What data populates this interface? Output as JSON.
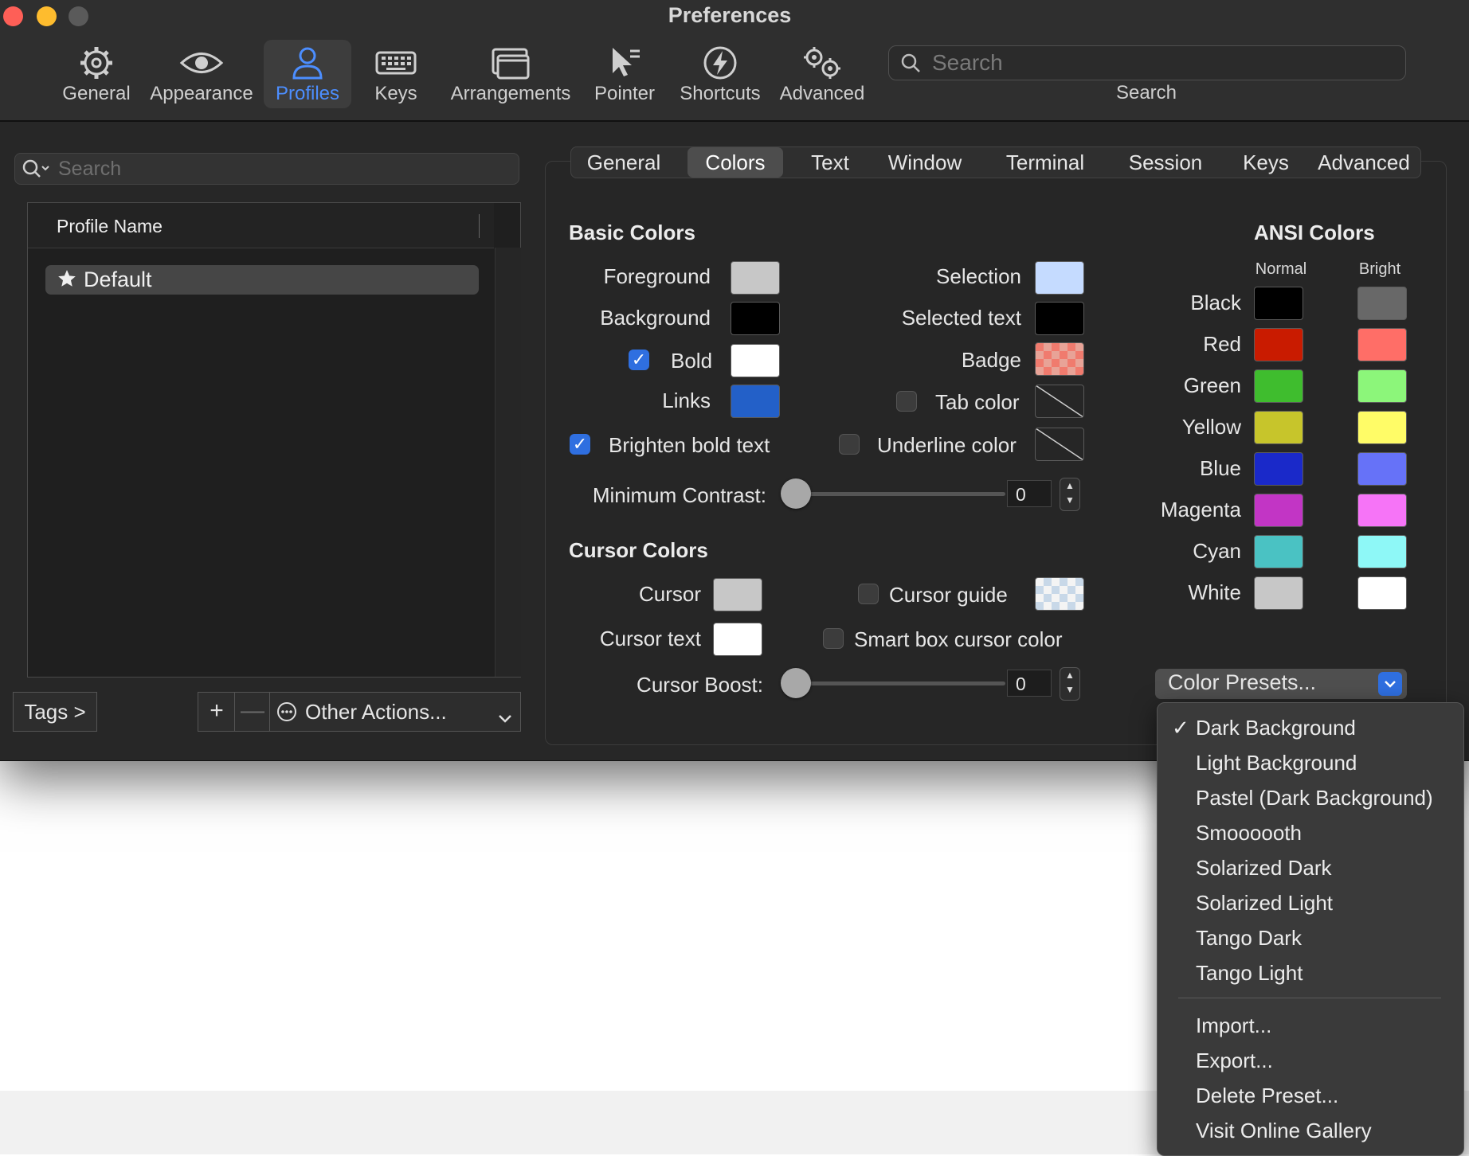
{
  "window": {
    "title": "Preferences"
  },
  "toolbar": {
    "items": [
      {
        "label": "General",
        "icon": "gear-icon"
      },
      {
        "label": "Appearance",
        "icon": "eye-icon"
      },
      {
        "label": "Profiles",
        "icon": "person-icon",
        "selected": true
      },
      {
        "label": "Keys",
        "icon": "keyboard-icon"
      },
      {
        "label": "Arrangements",
        "icon": "windows-icon"
      },
      {
        "label": "Pointer",
        "icon": "pointer-icon"
      },
      {
        "label": "Shortcuts",
        "icon": "bolt-icon"
      },
      {
        "label": "Advanced",
        "icon": "gears-icon"
      }
    ],
    "search_placeholder": "Search",
    "search_label": "Search"
  },
  "sidebar": {
    "search_placeholder": "Search",
    "column_header": "Profile Name",
    "profiles": [
      {
        "name": "Default",
        "starred": true,
        "selected": true
      }
    ],
    "tags_label": "Tags >",
    "add_label": "+",
    "remove_label": "—",
    "other_actions_label": "Other Actions..."
  },
  "tabs": [
    "General",
    "Colors",
    "Text",
    "Window",
    "Terminal",
    "Session",
    "Keys",
    "Advanced"
  ],
  "active_tab": "Colors",
  "basic_colors": {
    "heading": "Basic Colors",
    "foreground": {
      "label": "Foreground",
      "color": "#c7c7c7"
    },
    "background": {
      "label": "Background",
      "color": "#000000"
    },
    "bold": {
      "label": "Bold",
      "color": "#ffffff",
      "checked": true
    },
    "links": {
      "label": "Links",
      "color": "#2360c8"
    },
    "selection": {
      "label": "Selection",
      "color": "#c5dbff"
    },
    "selected_text": {
      "label": "Selected text",
      "color": "#000000"
    },
    "badge": {
      "label": "Badge",
      "color": "#f07b6e"
    },
    "tab_color": {
      "label": "Tab color",
      "checked": false
    },
    "underline_color": {
      "label": "Underline color",
      "checked": false
    },
    "brighten_bold": {
      "label": "Brighten bold text",
      "checked": true
    },
    "minimum_contrast": {
      "label": "Minimum Contrast:",
      "value": "0"
    }
  },
  "cursor_colors": {
    "heading": "Cursor Colors",
    "cursor": {
      "label": "Cursor",
      "color": "#c7c7c7"
    },
    "cursor_text": {
      "label": "Cursor text",
      "color": "#ffffff"
    },
    "cursor_guide": {
      "label": "Cursor guide",
      "checked": false
    },
    "smart_box": {
      "label": "Smart box cursor color",
      "checked": false
    },
    "cursor_boost": {
      "label": "Cursor Boost:",
      "value": "0"
    }
  },
  "ansi": {
    "heading": "ANSI Colors",
    "normal_label": "Normal",
    "bright_label": "Bright",
    "rows": [
      {
        "name": "Black",
        "normal": "#000000",
        "bright": "#686868"
      },
      {
        "name": "Red",
        "normal": "#c91b00",
        "bright": "#ff6e67"
      },
      {
        "name": "Green",
        "normal": "#3fbd2e",
        "bright": "#8cf67a"
      },
      {
        "name": "Yellow",
        "normal": "#c7c52b",
        "bright": "#fffc67"
      },
      {
        "name": "Blue",
        "normal": "#1a29c9",
        "bright": "#6672f8"
      },
      {
        "name": "Magenta",
        "normal": "#c235c5",
        "bright": "#f674f7"
      },
      {
        "name": "Cyan",
        "normal": "#4ac2c3",
        "bright": "#8ef8f7"
      },
      {
        "name": "White",
        "normal": "#c7c7c7",
        "bright": "#ffffff"
      }
    ]
  },
  "color_presets": {
    "button_label": "Color Presets...",
    "items": [
      {
        "label": "Dark Background",
        "checked": true
      },
      {
        "label": "Light Background"
      },
      {
        "label": "Pastel (Dark Background)"
      },
      {
        "label": "Smoooooth"
      },
      {
        "label": "Solarized Dark"
      },
      {
        "label": "Solarized Light"
      },
      {
        "label": "Tango Dark"
      },
      {
        "label": "Tango Light"
      }
    ],
    "actions": [
      "Import...",
      "Export...",
      "Delete Preset...",
      "Visit Online Gallery"
    ]
  }
}
